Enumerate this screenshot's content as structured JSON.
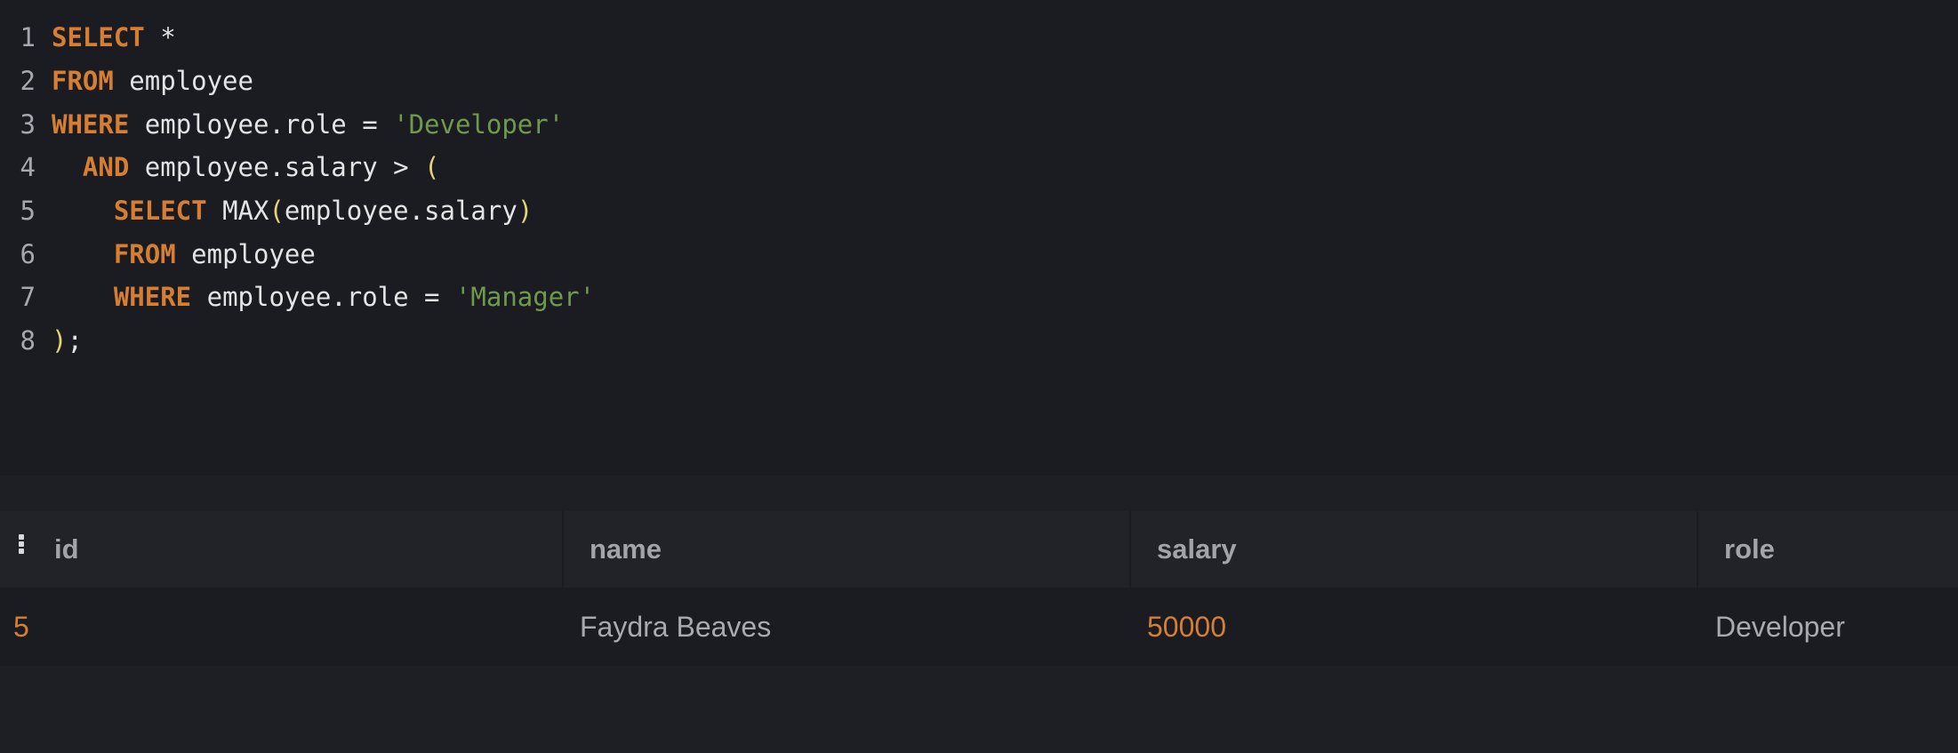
{
  "editor": {
    "lines": [
      {
        "n": "1",
        "tokens": [
          {
            "t": "SELECT",
            "k": "kw"
          },
          {
            "t": " *",
            "k": "id"
          }
        ]
      },
      {
        "n": "2",
        "tokens": [
          {
            "t": "FROM",
            "k": "kw"
          },
          {
            "t": " employee",
            "k": "id"
          }
        ]
      },
      {
        "n": "3",
        "tokens": [
          {
            "t": "WHERE",
            "k": "kw"
          },
          {
            "t": " employee.role = ",
            "k": "id"
          },
          {
            "t": "'Developer'",
            "k": "str"
          }
        ]
      },
      {
        "n": "4",
        "tokens": [
          {
            "t": "  ",
            "k": "id"
          },
          {
            "t": "AND",
            "k": "kw"
          },
          {
            "t": " employee.salary > ",
            "k": "id"
          },
          {
            "t": "(",
            "k": "par"
          }
        ]
      },
      {
        "n": "5",
        "tokens": [
          {
            "t": "    ",
            "k": "id"
          },
          {
            "t": "SELECT",
            "k": "kw"
          },
          {
            "t": " MAX",
            "k": "id"
          },
          {
            "t": "(",
            "k": "par"
          },
          {
            "t": "employee.salary",
            "k": "id"
          },
          {
            "t": ")",
            "k": "par"
          }
        ]
      },
      {
        "n": "6",
        "tokens": [
          {
            "t": "    ",
            "k": "id"
          },
          {
            "t": "FROM",
            "k": "kw"
          },
          {
            "t": " employee",
            "k": "id"
          }
        ]
      },
      {
        "n": "7",
        "tokens": [
          {
            "t": "    ",
            "k": "id"
          },
          {
            "t": "WHERE",
            "k": "kw"
          },
          {
            "t": " employee.role = ",
            "k": "id"
          },
          {
            "t": "'Manager'",
            "k": "str"
          }
        ]
      },
      {
        "n": "8",
        "tokens": [
          {
            "t": ")",
            "k": "par"
          },
          {
            "t": ";",
            "k": "id"
          }
        ]
      }
    ]
  },
  "results": {
    "columns": [
      "id",
      "name",
      "salary",
      "role"
    ],
    "rows": [
      {
        "id": "5",
        "name": "Faydra Beaves",
        "salary": "50000",
        "role": "Developer"
      }
    ],
    "menu_icon": "vertical-dots-icon"
  },
  "colors": {
    "keyword": "#d67f33",
    "identifier": "#e3e4e6",
    "string": "#6f9a4e",
    "paren": "#e3d277",
    "number": "#d67f33",
    "background": "#1b1c21"
  }
}
